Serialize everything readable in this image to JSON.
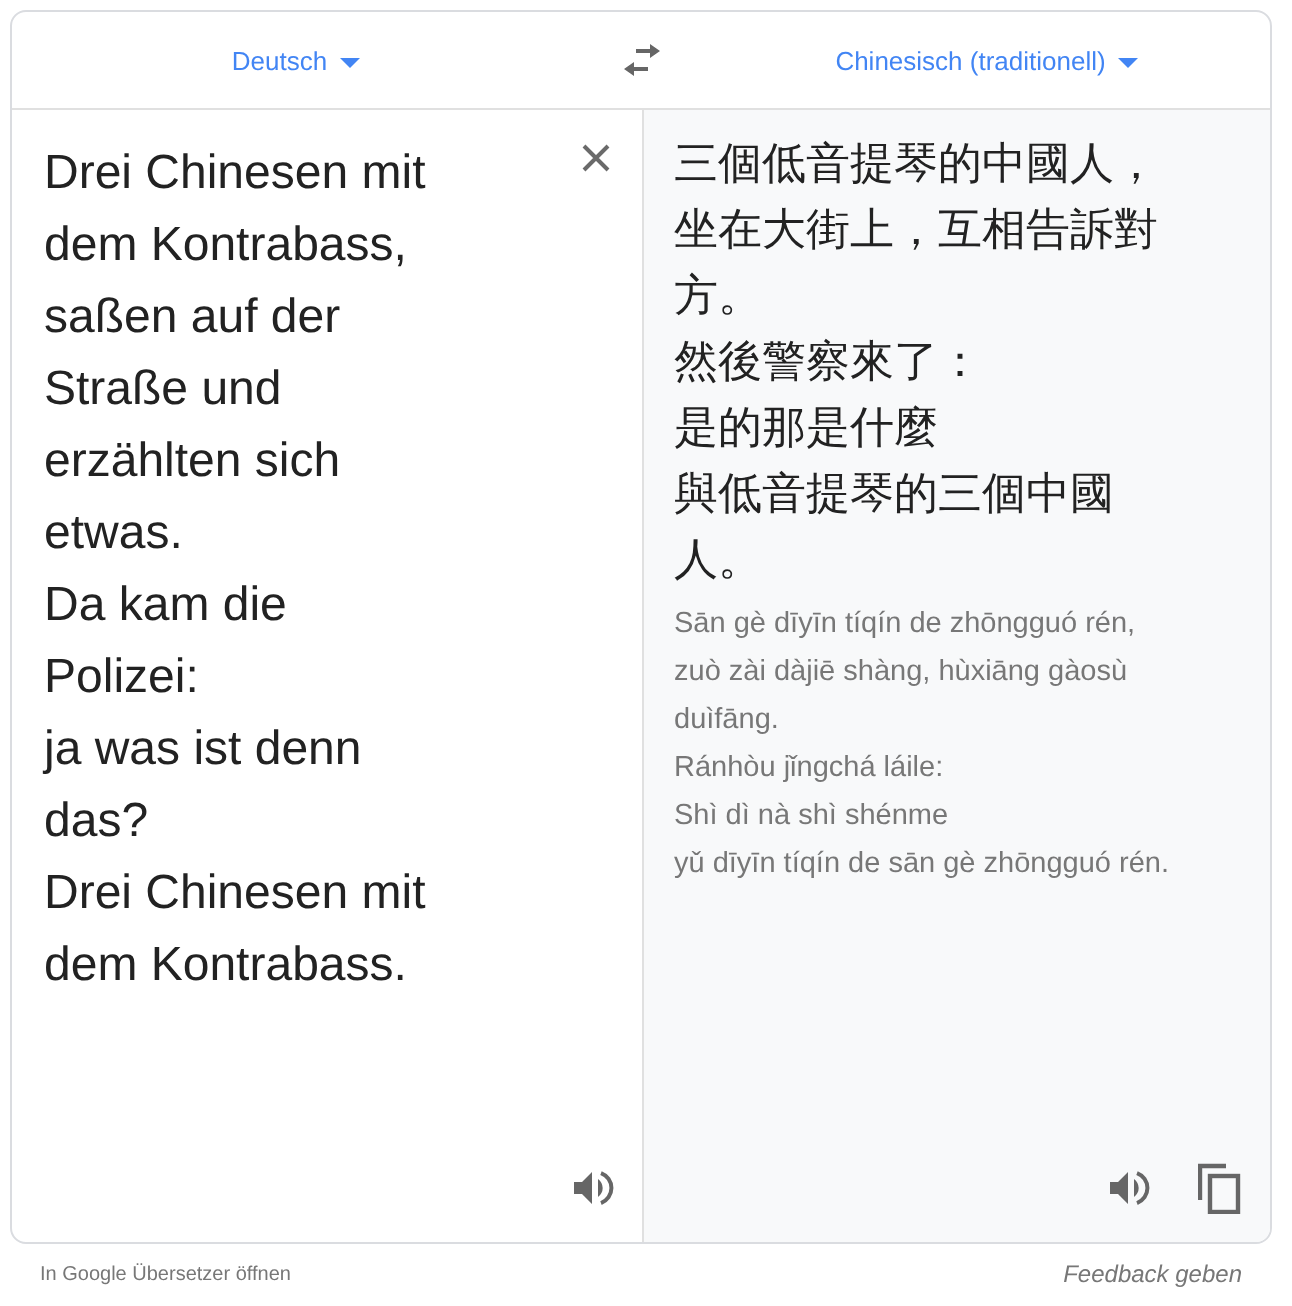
{
  "languages": {
    "source": "Deutsch",
    "target": "Chinesisch (traditionell)"
  },
  "source_lines": [
    "Drei Chinesen mit",
    "dem Kontrabass,",
    "saßen auf der",
    "Straße und",
    "erzählten sich",
    "etwas.",
    "Da kam die",
    "Polizei:",
    "ja was ist denn",
    "das?",
    "Drei Chinesen mit",
    "dem Kontrabass."
  ],
  "translation_lines": [
    "三個低音提琴的中國人，",
    "坐在大街上，互相告訴對",
    "方。",
    "然後警察來了：",
    "是的那是什麼",
    "與低音提琴的三個中國",
    "人。"
  ],
  "romanization_lines": [
    "Sān gè dīyīn tíqín de zhōngguó rén,",
    "zuò zài dàjiē shàng, hùxiāng gàosù",
    "duìfāng.",
    "Ránhòu jǐngchá láile:",
    "Shì dì nà shì shénme",
    "yǔ dīyīn tíqín de sān gè zhōngguó rén."
  ],
  "footer": {
    "open_link": "In Google Übersetzer öffnen",
    "feedback_link": "Feedback geben"
  }
}
